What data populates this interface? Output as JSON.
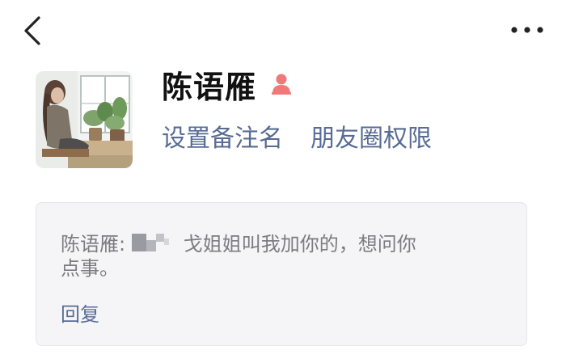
{
  "contact": {
    "name": "陈语雁",
    "gender_icon": "female-icon",
    "avatar": "profile-photo"
  },
  "actions": {
    "set_remark_label": "设置备注名",
    "moments_permission_label": "朋友圈权限"
  },
  "friend_request": {
    "sender_prefix": "陈语雁:",
    "message_visible_part1": "戈姐姐叫我加你的，想问你",
    "message_visible_part2": "点事。",
    "reply_label": "回复"
  },
  "nav": {
    "back_icon": "chevron-left-icon",
    "more_icon": "more-icon"
  },
  "colors": {
    "link": "#576b95",
    "gender_female": "#f07a7a",
    "card_bg": "#f5f5f7",
    "message_text": "#7b7b82"
  }
}
